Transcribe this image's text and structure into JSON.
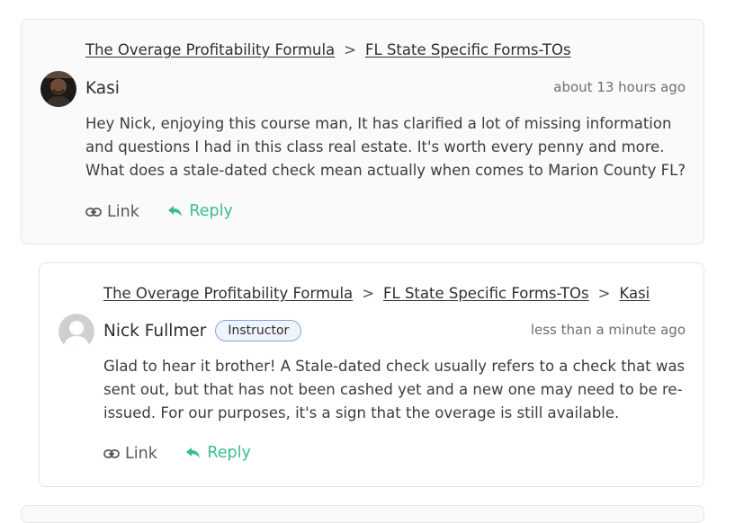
{
  "comments": [
    {
      "breadcrumb": [
        "The Overage Profitability Formula",
        "FL State Specific Forms-TOs"
      ],
      "author": "Kasi",
      "badge": "",
      "time": "about 13 hours ago",
      "body": "Hey Nick, enjoying this course man, It has clarified a lot of missing information and questions I had in this class real estate. It's worth every penny and more. What does a stale-dated check mean actually when comes to Marion County FL?",
      "link_label": "Link",
      "reply_label": "Reply"
    },
    {
      "breadcrumb": [
        "The Overage Profitability Formula",
        "FL State Specific Forms-TOs",
        "Kasi"
      ],
      "author": "Nick Fullmer",
      "badge": "Instructor",
      "time": "less than a minute ago",
      "body": "Glad to hear it brother! A Stale-dated check usually refers to a check that was sent out, but that has not been cashed yet and a new one may need to be re-issued. For our purposes, it's a sign that the overage is still available.",
      "link_label": "Link",
      "reply_label": "Reply"
    }
  ],
  "breadcrumb_separator": ">",
  "colors": {
    "reply": "#3bbf8a",
    "badge_border": "#8aa4d6",
    "badge_bg": "#eef3fc"
  },
  "icons": {
    "link": "link-icon",
    "reply": "reply-arrow-icon",
    "avatar_placeholder": "user-silhouette-icon"
  }
}
